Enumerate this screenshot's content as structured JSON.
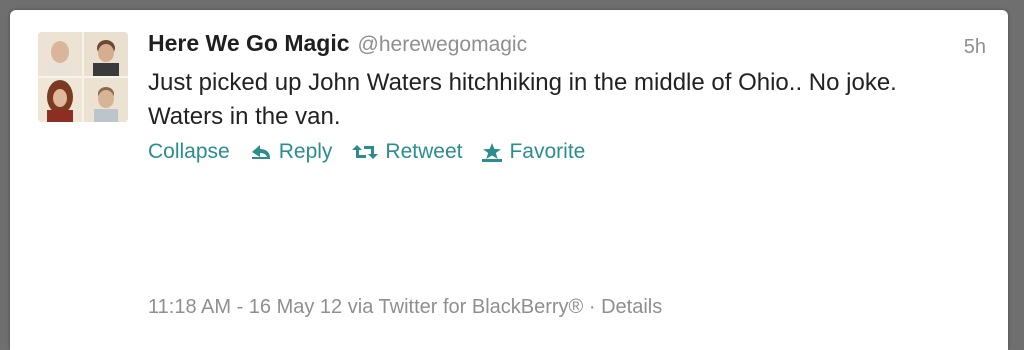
{
  "tweet": {
    "user_name": "Here We Go Magic",
    "user_handle": "@herewegomagic",
    "time_ago": "5h",
    "text": "Just picked up John Waters hitchhiking in the middle of Ohio.. No joke. Waters in the van.",
    "actions": {
      "collapse": "Collapse",
      "reply": "Reply",
      "retweet": "Retweet",
      "favorite": "Favorite"
    },
    "footer": {
      "timestamp": "11:18 AM - 16 May 12",
      "via": "via Twitter for BlackBerry®",
      "separator": "·",
      "details": "Details"
    }
  },
  "icons": {
    "reply": "reply-arrow-icon",
    "retweet": "retweet-arrows-icon",
    "favorite": "star-icon"
  },
  "colors": {
    "background": "#6f6f6f",
    "card": "#ffffff",
    "link": "#2a8e8e",
    "meta_text": "#8f8f8f",
    "body_text": "#222222"
  }
}
